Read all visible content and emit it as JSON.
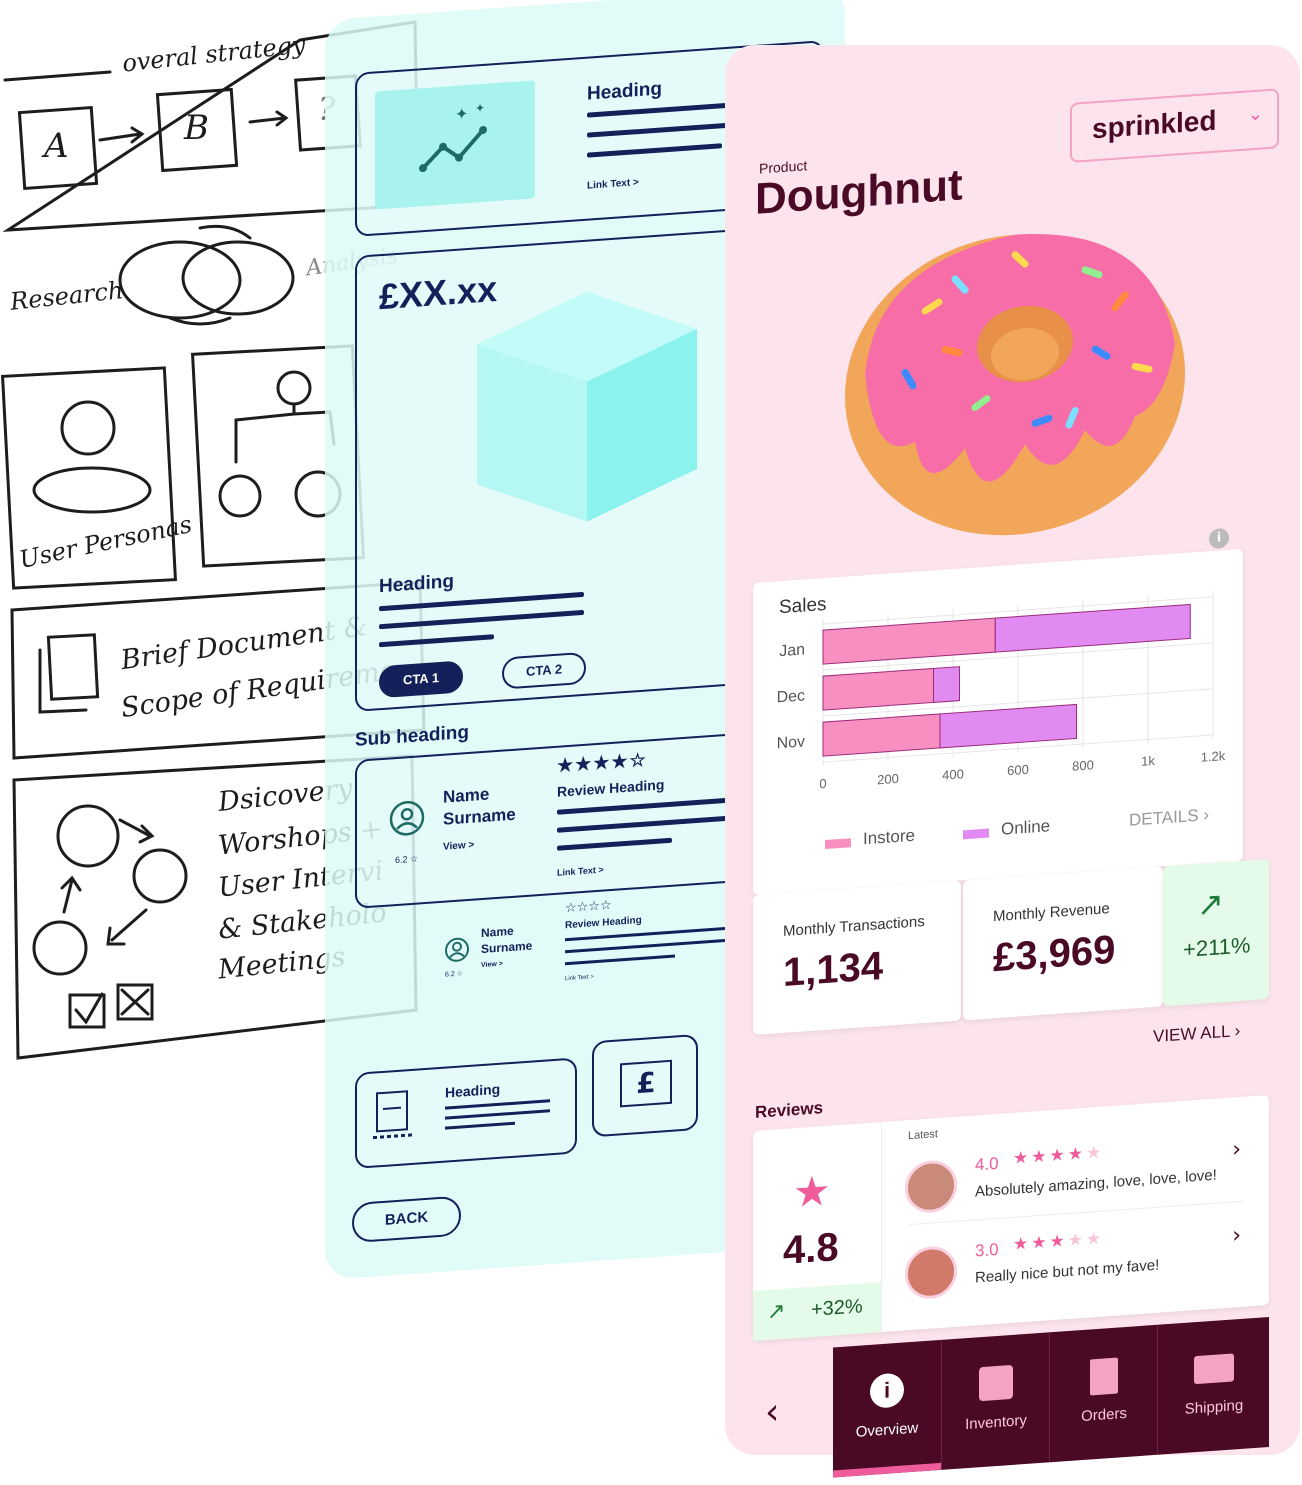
{
  "sketch": {
    "strategy_title": "overal strategy",
    "box_a": "A",
    "box_b": "B",
    "box_q": "?",
    "research": "Research",
    "analysis": "Analysis",
    "personas": "User Personas",
    "brief_line1": "Brief Document &",
    "brief_line2": "Scope of Requireme",
    "discovery_lines": [
      "Dsicovery",
      "Worshops +",
      "User Intervi",
      "& Stakeholo",
      "Meetings"
    ]
  },
  "wireframe": {
    "top_card": {
      "heading": "Heading",
      "link": "Link Text >"
    },
    "product_card": {
      "price": "£XX.xx",
      "heading": "Heading",
      "cta1": "CTA 1",
      "cta2": "CTA 2"
    },
    "sub_heading": "Sub heading",
    "review_card": {
      "name": "Name",
      "surname": "Surname",
      "view": "View >",
      "rating": "6.2 ☆",
      "stars": "★★★★☆",
      "review_heading": "Review Heading",
      "link": "Link Text >"
    },
    "review_card_small": {
      "name": "Name",
      "surname": "Surname",
      "view": "View >",
      "rating": "6.2 ☆",
      "stars": "☆☆☆☆",
      "review_heading": "Review Heading",
      "link": "Link Text >"
    },
    "bottom_card": {
      "heading": "Heading"
    },
    "back_button": "BACK"
  },
  "app": {
    "product_label": "Product",
    "product_name": "Doughnut",
    "variant_select": "sprinkled",
    "sales_title": "Sales",
    "details_link": "DETAILS",
    "monthly_transactions_label": "Monthly Transactions",
    "monthly_transactions_value": "1,134",
    "monthly_revenue_label": "Monthly Revenue",
    "monthly_revenue_value": "£3,969",
    "revenue_change": "+211%",
    "view_all": "VIEW ALL",
    "reviews_title": "Reviews",
    "avg_rating": "4.8",
    "rating_change": "+32%",
    "latest_label": "Latest",
    "reviews": [
      {
        "rating": "4.0",
        "stars": 4,
        "text": "Absolutely amazing, love, love, love!"
      },
      {
        "rating": "3.0",
        "stars": 3,
        "text": "Really nice but not my fave!"
      }
    ],
    "nav": [
      {
        "label": "Overview",
        "icon": "info-icon",
        "active": true
      },
      {
        "label": "Inventory",
        "icon": "archive-box-icon",
        "active": false
      },
      {
        "label": "Orders",
        "icon": "receipt-icon",
        "active": false
      },
      {
        "label": "Shipping",
        "icon": "truck-icon",
        "active": false
      }
    ],
    "colors": {
      "instore": "#f78fc0",
      "online": "#e08af2",
      "primary": "#4a0a26",
      "accent": "#ee5c9c"
    }
  },
  "chart_data": {
    "type": "bar",
    "orientation": "horizontal",
    "stacked": true,
    "title": "Sales",
    "categories": [
      "Jan",
      "Dec",
      "Nov"
    ],
    "series": [
      {
        "name": "Instore",
        "values": [
          530,
          340,
          360
        ]
      },
      {
        "name": "Online",
        "values": [
          600,
          80,
          420
        ]
      }
    ],
    "xlim": [
      0,
      1200
    ],
    "x_ticks": [
      "0",
      "200",
      "400",
      "600",
      "800",
      "1k",
      "1.2k"
    ],
    "grid": true,
    "legend": "bottom"
  }
}
